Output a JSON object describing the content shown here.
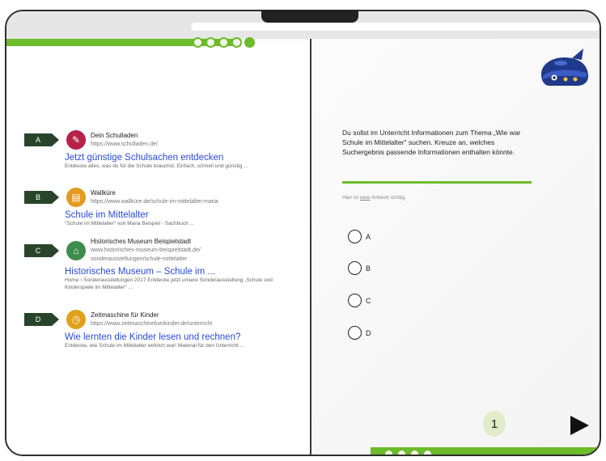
{
  "results": [
    {
      "tag": "A",
      "site_name": "Dein Schulladen",
      "url": "https://www.schulladen.de/",
      "title": "Jetzt günstige Schulsachen entdecken",
      "description": "Entdecke alles, was du für die Schule brauchst. Einfach, schnell und günstig ...",
      "logo_color": "#b5224a",
      "logo_glyph": "✎"
    },
    {
      "tag": "B",
      "site_name": "Wallküre",
      "url": "https://www.wallküre.de/schule-im-mittelalter-maria",
      "title": "Schule im Mittelalter",
      "description": "\"Schule im Mittelalter\" von Maria Beispiel - Sachbuch ...",
      "logo_color": "#e39a1e",
      "logo_glyph": "📖"
    },
    {
      "tag": "C",
      "site_name": "Historisches Museum Beispielstadt",
      "url": "www.historisches-museum-beispielstadt.de/ sonderausstellungen/schule-mittelalter",
      "title": "Historisches Museum – Schule im ...",
      "description": "Home › Sonderausstellungen 2017 Entdecke jetzt unsere Sonderausstellung „Schule und Kinderspiele im Mittelalter\" ...",
      "logo_color": "#3d8c4a",
      "logo_glyph": "⌂"
    },
    {
      "tag": "D",
      "site_name": "Zeitmaschine für Kinder",
      "url": "https://www.zeitmaschinefuerkinder.de/unterricht",
      "title": "Wie lernten die Kinder lesen und rechnen?",
      "description": "Entdecke, wie Schule im Mittelalter wirklich war! Material für den Unterricht ...",
      "logo_color": "#e0a21a",
      "logo_glyph": "◷"
    }
  ],
  "question": "Du sollst im Unterricht Informationen zum Thema „Wie war Schule im Mittelalter\" suchen. Kreuze an, welches Suchergebnis passende Informationen enthalten könnte.",
  "hint_prefix": "Hier ist ",
  "hint_emph": "eine",
  "hint_suffix": " Antwort richtig.",
  "options": [
    "A",
    "B",
    "C",
    "D"
  ],
  "page_number": "1",
  "colors": {
    "accent": "#6cbb2a",
    "link": "#2a4ad6",
    "tag": "#28452b"
  },
  "icons": {
    "next": "play-triangle-icon",
    "mascot": "whale-mascot-icon"
  }
}
